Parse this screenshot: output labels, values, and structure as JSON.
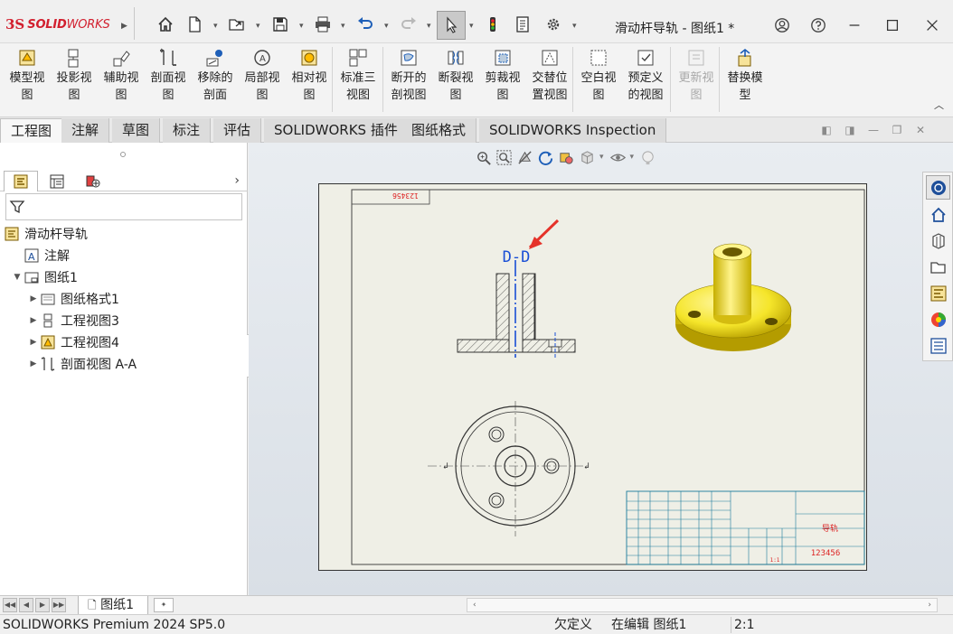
{
  "app": {
    "logo_ds": "3S",
    "logo_brand_bold": "SOLID",
    "logo_brand_rest": "WORKS",
    "doc_title": "滑动杆导轨 - 图纸1 *"
  },
  "quick_access": [
    {
      "name": "home-icon"
    },
    {
      "name": "new-document-icon"
    },
    {
      "name": "open-folder-icon"
    },
    {
      "name": "save-icon"
    },
    {
      "name": "print-icon"
    },
    {
      "name": "undo-icon"
    },
    {
      "name": "redo-icon"
    },
    {
      "name": "select-pointer-icon"
    },
    {
      "name": "rebuild-traffic-light-icon"
    },
    {
      "name": "file-properties-icon"
    },
    {
      "name": "options-gear-icon"
    }
  ],
  "window_controls": [
    {
      "name": "account-icon"
    },
    {
      "name": "help-icon"
    },
    {
      "name": "minimize-icon"
    },
    {
      "name": "maximize-icon"
    },
    {
      "name": "close-icon"
    }
  ],
  "ribbon": {
    "buttons": [
      {
        "label": "模型视\n图",
        "icon": "model-view-icon",
        "enabled": true
      },
      {
        "label": "投影视\n图",
        "icon": "projected-view-icon",
        "enabled": true
      },
      {
        "label": "辅助视\n图",
        "icon": "auxiliary-view-icon",
        "enabled": true
      },
      {
        "label": "剖面视\n图",
        "icon": "section-view-icon",
        "enabled": true
      },
      {
        "label": "移除的\n剖面",
        "icon": "removed-section-icon",
        "enabled": true
      },
      {
        "label": "局部视\n图",
        "icon": "detail-view-icon",
        "enabled": true
      },
      {
        "label": "相对视\n图",
        "icon": "relative-view-icon",
        "enabled": true
      },
      {
        "label": "标准三\n视图",
        "icon": "standard-3-view-icon",
        "enabled": true
      },
      {
        "label": "断开的\n剖视图",
        "icon": "broken-out-section-icon",
        "enabled": true
      },
      {
        "label": "断裂视\n图",
        "icon": "break-view-icon",
        "enabled": true
      },
      {
        "label": "剪裁视\n图",
        "icon": "crop-view-icon",
        "enabled": true
      },
      {
        "label": "交替位\n置视图",
        "icon": "alternate-position-view-icon",
        "enabled": true
      },
      {
        "label": "空白视\n图",
        "icon": "empty-view-icon",
        "enabled": true
      },
      {
        "label": "预定义\n的视图",
        "icon": "predefined-view-icon",
        "enabled": true
      },
      {
        "label": "更新视\n图",
        "icon": "update-view-icon",
        "enabled": false
      },
      {
        "label": "替换模\n型",
        "icon": "replace-model-icon",
        "enabled": true
      }
    ]
  },
  "tabs": [
    {
      "label": "工程图",
      "active": true
    },
    {
      "label": "注解",
      "active": false
    },
    {
      "label": "草图",
      "active": false
    },
    {
      "label": "标注",
      "active": false
    },
    {
      "label": "评估",
      "active": false
    },
    {
      "label": "SOLIDWORKS 插件",
      "active": false
    },
    {
      "label": "图纸格式",
      "active": false
    },
    {
      "label": "SOLIDWORKS Inspection",
      "active": false
    }
  ],
  "feature_tree": {
    "tabs": [
      {
        "name": "featuremanager-tab-icon"
      },
      {
        "name": "property-manager-tab-icon"
      },
      {
        "name": "display-manager-tab-icon"
      }
    ],
    "items": [
      {
        "label": "滑动杆导轨",
        "level": 0,
        "icon": "drawing-icon",
        "expand": ""
      },
      {
        "label": "注解",
        "level": 1,
        "icon": "annotation-icon",
        "expand": ""
      },
      {
        "label": "图纸1",
        "level": 1,
        "icon": "sheet-icon",
        "expand": "▼"
      },
      {
        "label": "图纸格式1",
        "level": 2,
        "icon": "sheet-format-icon",
        "expand": "▶"
      },
      {
        "label": "工程视图3",
        "level": 2,
        "icon": "drawing-view-icon",
        "expand": "▶"
      },
      {
        "label": "工程视图4",
        "level": 2,
        "icon": "model-view-small-icon",
        "expand": "▶"
      },
      {
        "label": "剖面视图 A-A",
        "level": 2,
        "icon": "section-view-small-icon",
        "expand": "▶"
      }
    ]
  },
  "drawing": {
    "section_label": "D-D",
    "stamp_text": "123456",
    "title_block_name": "导轨",
    "title_block_code": "123456",
    "scale_text": "1:1",
    "accent_color": "#1a4fd6",
    "model_color": "#f5e52a"
  },
  "sheet_tab": {
    "label": "图纸1"
  },
  "status": {
    "product": "SOLIDWORKS Premium 2024 SP5.0",
    "definition": "欠定义",
    "editing": "在编辑 图纸1",
    "scale": "2:1"
  }
}
